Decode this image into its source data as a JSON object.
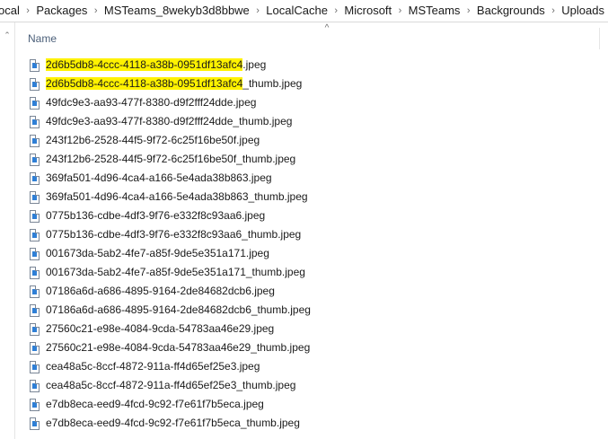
{
  "breadcrumb": {
    "items": [
      "ocal",
      "Packages",
      "MSTeams_8wekyb3d8bbwe",
      "LocalCache",
      "Microsoft",
      "MSTeams",
      "Backgrounds",
      "Uploads"
    ],
    "separator": "›"
  },
  "nav": {
    "chevron": "⌃"
  },
  "columns": {
    "name_label": "Name",
    "sort_indicator": "^"
  },
  "icons": {
    "file_icon": "image-file-icon"
  },
  "colors": {
    "highlight": "#fff200",
    "icon_accent": "#2f7fd6",
    "header_text": "#4c607a"
  },
  "files": [
    {
      "highlight": "2d6b5db8-4ccc-4118-a38b-0951df13afc4",
      "rest": ".jpeg"
    },
    {
      "highlight": "2d6b5db8-4ccc-4118-a38b-0951df13afc4",
      "rest": "_thumb.jpeg"
    },
    {
      "highlight": "",
      "rest": "49fdc9e3-aa93-477f-8380-d9f2fff24dde.jpeg"
    },
    {
      "highlight": "",
      "rest": "49fdc9e3-aa93-477f-8380-d9f2fff24dde_thumb.jpeg"
    },
    {
      "highlight": "",
      "rest": "243f12b6-2528-44f5-9f72-6c25f16be50f.jpeg"
    },
    {
      "highlight": "",
      "rest": "243f12b6-2528-44f5-9f72-6c25f16be50f_thumb.jpeg"
    },
    {
      "highlight": "",
      "rest": "369fa501-4d96-4ca4-a166-5e4ada38b863.jpeg"
    },
    {
      "highlight": "",
      "rest": "369fa501-4d96-4ca4-a166-5e4ada38b863_thumb.jpeg"
    },
    {
      "highlight": "",
      "rest": "0775b136-cdbe-4df3-9f76-e332f8c93aa6.jpeg"
    },
    {
      "highlight": "",
      "rest": "0775b136-cdbe-4df3-9f76-e332f8c93aa6_thumb.jpeg"
    },
    {
      "highlight": "",
      "rest": "001673da-5ab2-4fe7-a85f-9de5e351a171.jpeg"
    },
    {
      "highlight": "",
      "rest": "001673da-5ab2-4fe7-a85f-9de5e351a171_thumb.jpeg"
    },
    {
      "highlight": "",
      "rest": "07186a6d-a686-4895-9164-2de84682dcb6.jpeg"
    },
    {
      "highlight": "",
      "rest": "07186a6d-a686-4895-9164-2de84682dcb6_thumb.jpeg"
    },
    {
      "highlight": "",
      "rest": "27560c21-e98e-4084-9cda-54783aa46e29.jpeg"
    },
    {
      "highlight": "",
      "rest": "27560c21-e98e-4084-9cda-54783aa46e29_thumb.jpeg"
    },
    {
      "highlight": "",
      "rest": "cea48a5c-8ccf-4872-911a-ff4d65ef25e3.jpeg"
    },
    {
      "highlight": "",
      "rest": "cea48a5c-8ccf-4872-911a-ff4d65ef25e3_thumb.jpeg"
    },
    {
      "highlight": "",
      "rest": "e7db8eca-eed9-4fcd-9c92-f7e61f7b5eca.jpeg"
    },
    {
      "highlight": "",
      "rest": "e7db8eca-eed9-4fcd-9c92-f7e61f7b5eca_thumb.jpeg"
    }
  ]
}
